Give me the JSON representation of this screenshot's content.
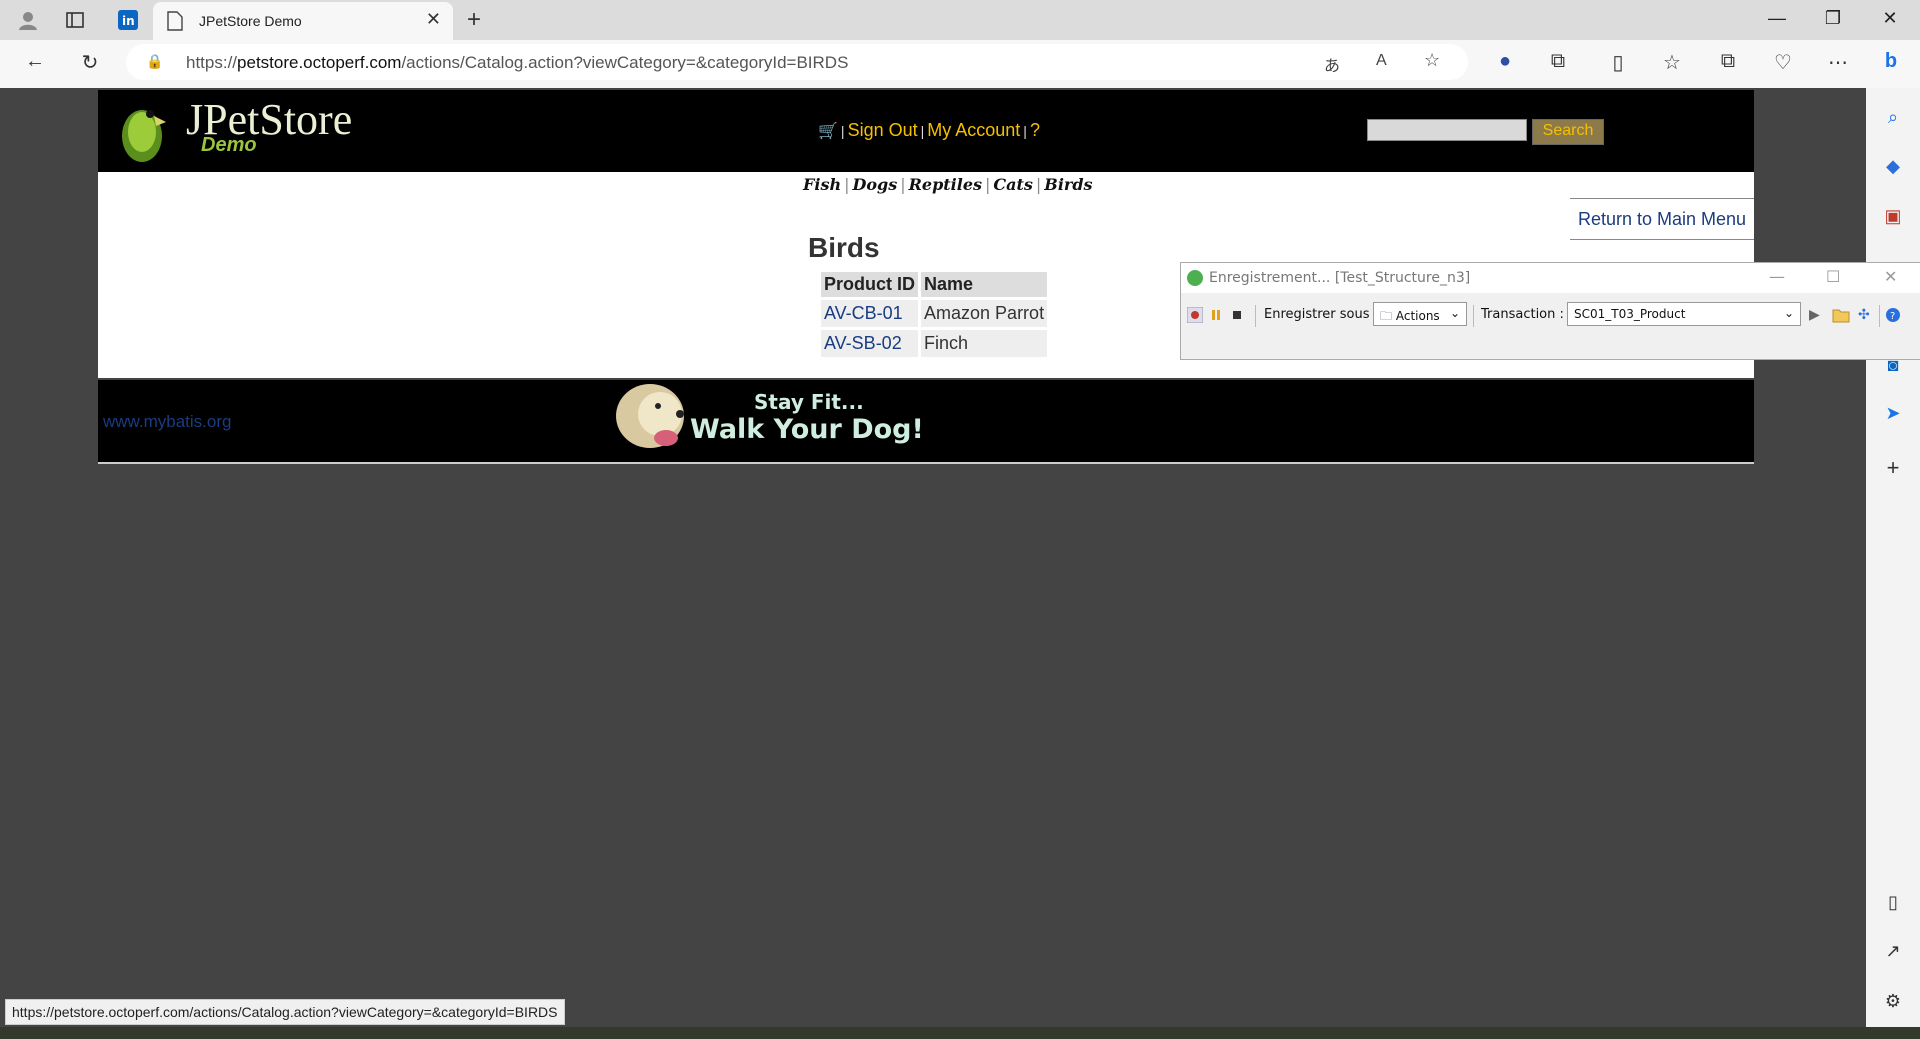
{
  "browser": {
    "tab_title": "JPetStore Demo",
    "url_domain": "petstore.octoperf.com",
    "url_prefix": "https://",
    "url_path": "/actions/Catalog.action?viewCategory=&categoryId=BIRDS",
    "status_url": "https://petstore.octoperf.com/actions/Catalog.action?viewCategory=&categoryId=BIRDS"
  },
  "header": {
    "logo_text": "JPetStore",
    "logo_sub": "Demo",
    "sign_out": "Sign Out",
    "my_account": "My Account",
    "help": "?",
    "search_button": "Search",
    "search_value": ""
  },
  "quicklinks": [
    "Fish",
    "Dogs",
    "Reptiles",
    "Cats",
    "Birds"
  ],
  "content": {
    "return_link": "Return to Main Menu",
    "category_title": "Birds",
    "table": {
      "headers": [
        "Product ID",
        "Name"
      ],
      "rows": [
        {
          "id": "AV-CB-01",
          "name": "Amazon Parrot"
        },
        {
          "id": "AV-SB-02",
          "name": "Finch"
        }
      ]
    }
  },
  "footer": {
    "mybatis": "www.mybatis.org",
    "banner_line1": "Stay Fit...",
    "banner_line2": "Walk Your Dog!"
  },
  "recorder": {
    "title": "Enregistrement... [Test_Structure_n3]",
    "save_under_label": "Enregistrer sous :",
    "save_under_value": "Actions",
    "transaction_label": "Transaction :",
    "transaction_value": "SC01_T03_Product"
  },
  "colors": {
    "link_yellow": "#f5c000",
    "link_blue": "#1a3c80",
    "page_bg": "#444444"
  }
}
